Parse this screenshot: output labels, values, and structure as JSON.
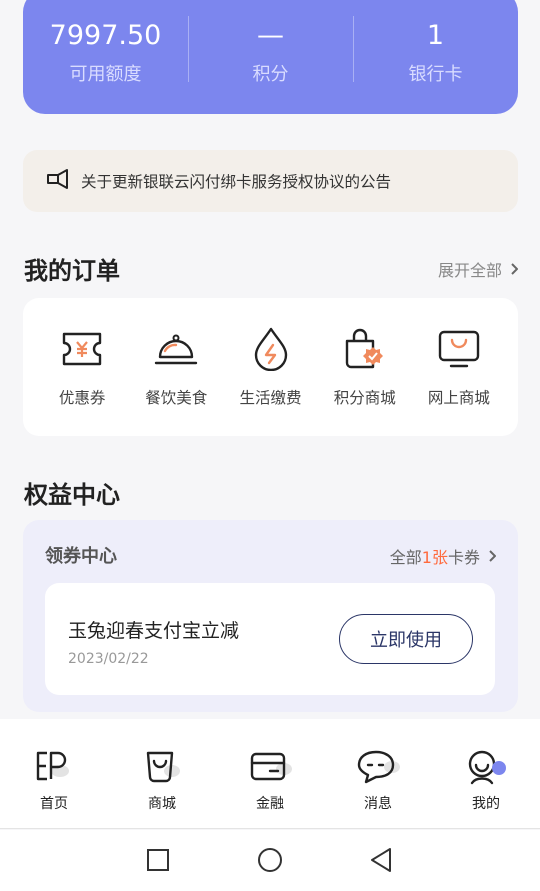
{
  "stats": [
    {
      "value": "7997.50",
      "label": "可用额度"
    },
    {
      "value": "—",
      "label": "积分"
    },
    {
      "value": "1",
      "label": "银行卡"
    }
  ],
  "notice": {
    "icon": "megaphone-icon",
    "text": "关于更新银联云闪付绑卡服务授权协议的公告"
  },
  "orders": {
    "title": "我的订单",
    "more_label": "展开全部",
    "items": [
      {
        "label": "优惠券",
        "icon": "coupon-ticket-icon"
      },
      {
        "label": "餐饮美食",
        "icon": "food-cloche-icon"
      },
      {
        "label": "生活缴费",
        "icon": "utility-drop-icon"
      },
      {
        "label": "积分商城",
        "icon": "points-bag-icon"
      },
      {
        "label": "网上商城",
        "icon": "tv-shop-icon"
      }
    ]
  },
  "benefits": {
    "title": "权益中心",
    "coupon_center": {
      "title": "领券中心",
      "all_prefix": "全部",
      "count": "1张",
      "all_suffix": "卡券",
      "coupon": {
        "name": "玉兔迎春支付宝立减",
        "date": "2023/02/22",
        "button": "立即使用"
      }
    }
  },
  "tabbar": [
    {
      "label": "首页",
      "icon": "home-icon"
    },
    {
      "label": "商城",
      "icon": "shop-bag-icon"
    },
    {
      "label": "金融",
      "icon": "card-wallet-icon"
    },
    {
      "label": "消息",
      "icon": "message-bubble-icon"
    },
    {
      "label": "我的",
      "icon": "profile-icon",
      "active": true
    }
  ],
  "colors": {
    "accent": "#7c86ee",
    "highlight": "#ff6a3d",
    "icon_accent": "#f08a5d",
    "button_border": "#2b3667"
  }
}
